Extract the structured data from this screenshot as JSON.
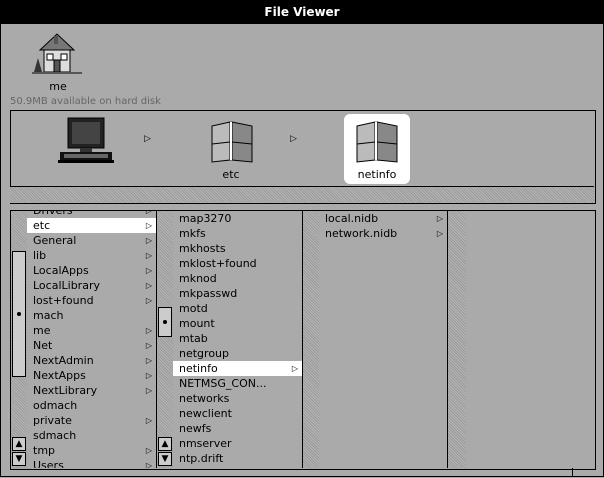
{
  "window": {
    "title": "File Viewer"
  },
  "shelf": {
    "home_label": "me",
    "disk_status": "50.9MB available on hard disk"
  },
  "path": [
    {
      "label": "",
      "icon": "computer-icon"
    },
    {
      "label": "etc",
      "icon": "folder-icon"
    },
    {
      "label": "netinfo",
      "icon": "folder-icon",
      "selected": true
    }
  ],
  "columns": [
    {
      "items": [
        {
          "label": "Drivers",
          "folder": true,
          "partial": true
        },
        {
          "label": "etc",
          "folder": true,
          "selected": true
        },
        {
          "label": "General",
          "folder": true
        },
        {
          "label": "lib",
          "folder": true
        },
        {
          "label": "LocalApps",
          "folder": true
        },
        {
          "label": "LocalLibrary",
          "folder": true
        },
        {
          "label": "lost+found",
          "folder": true
        },
        {
          "label": "mach",
          "folder": false
        },
        {
          "label": "me",
          "folder": true
        },
        {
          "label": "Net",
          "folder": true
        },
        {
          "label": "NextAdmin",
          "folder": true
        },
        {
          "label": "NextApps",
          "folder": true
        },
        {
          "label": "NextLibrary",
          "folder": true
        },
        {
          "label": "odmach",
          "folder": false
        },
        {
          "label": "private",
          "folder": true
        },
        {
          "label": "sdmach",
          "folder": false
        },
        {
          "label": "tmp",
          "folder": true
        },
        {
          "label": "Users",
          "folder": true
        }
      ]
    },
    {
      "items": [
        {
          "label": "map3270",
          "folder": false
        },
        {
          "label": "mkfs",
          "folder": false
        },
        {
          "label": "mkhosts",
          "folder": false
        },
        {
          "label": "mklost+found",
          "folder": false
        },
        {
          "label": "mknod",
          "folder": false
        },
        {
          "label": "mkpasswd",
          "folder": false
        },
        {
          "label": "motd",
          "folder": false
        },
        {
          "label": "mount",
          "folder": false
        },
        {
          "label": "mtab",
          "folder": false
        },
        {
          "label": "netgroup",
          "folder": false
        },
        {
          "label": "netinfo",
          "folder": true,
          "selected": true
        },
        {
          "label": "NETMSG_CON...",
          "folder": false
        },
        {
          "label": "networks",
          "folder": false
        },
        {
          "label": "newclient",
          "folder": false
        },
        {
          "label": "newfs",
          "folder": false
        },
        {
          "label": "nmserver",
          "folder": false
        },
        {
          "label": "ntp.drift",
          "folder": false
        }
      ]
    },
    {
      "items": [
        {
          "label": "local.nidb",
          "folder": true
        },
        {
          "label": "network.nidb",
          "folder": true
        }
      ]
    }
  ],
  "icons": {
    "arrow": "▷",
    "scroll_up": "▲",
    "scroll_down": "▼"
  }
}
